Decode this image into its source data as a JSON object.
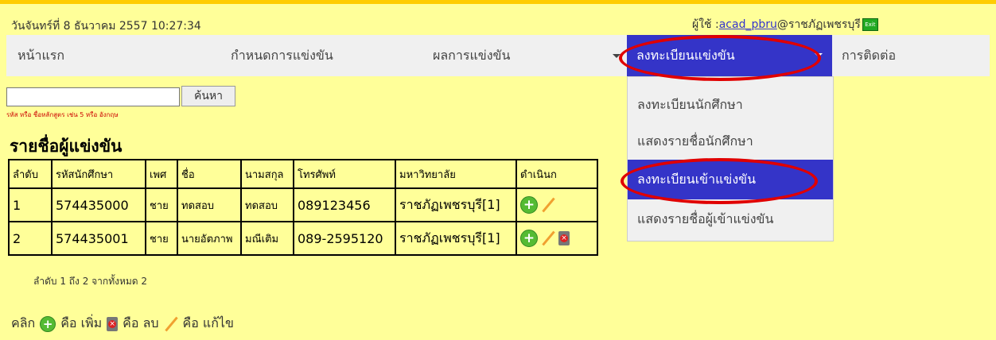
{
  "header": {
    "datetime": "วันจันทร์ที่ 8 ธันวาคม 2557 10:27:34",
    "user_label": "ผู้ใช้ :",
    "username": "acad_pbru",
    "user_org": "@ราชภัฏเพชรบุรี",
    "exit_label": "Exit"
  },
  "nav": {
    "home": "หน้าแรก",
    "schedule": "กำหนดการแข่งขัน",
    "results": "ผลการแข่งขัน",
    "register": "ลงทะเบียนแข่งขัน",
    "contact": "การติดต่อ"
  },
  "dropdown": {
    "items": [
      "ลงทะเบียนนักศึกษา",
      "แสดงรายชื่อนักศึกษา",
      "ลงทะเบียนเข้าแข่งขัน",
      "แสดงรายชื่อผู้เข้าแข่งขัน"
    ],
    "active_index": 2
  },
  "search": {
    "value": "",
    "button": "ค้นหา",
    "hint": "รหัส หรือ ชื่อหลักสูตร เช่น 5 หรือ อังกฤษ"
  },
  "list": {
    "title": "รายชื่อผู้แข่งขัน",
    "columns": [
      "ลำดับ",
      "รหัสนักศึกษา",
      "เพศ",
      "ชื่อ",
      "นามสกุล",
      "โทรศัพท์",
      "มหาวิทยาลัย",
      "ดำเนินก"
    ],
    "rows": [
      {
        "no": "1",
        "student_id": "574435000",
        "gender": "ชาย",
        "first_name": "ทดสอบ",
        "last_name": "ทดสอบ",
        "phone": "089123456",
        "university": "ราชภัฏเพชรบุรี[1]"
      },
      {
        "no": "2",
        "student_id": "574435001",
        "gender": "ชาย",
        "first_name": "นายอัตภาพ",
        "last_name": "มณีเติม",
        "phone": "089-2595120",
        "university": "ราชภัฏเพชรบุรี[1]"
      }
    ],
    "paging": "ลำดับ 1 ถึง 2 จากทั้งหมด 2"
  },
  "legend": {
    "click": "คลิก",
    "add": "คือ เพิ่ม",
    "delete": "คือ ลบ",
    "edit": "คือ แก้ไข"
  },
  "colors": {
    "background": "#ffff99",
    "menu_active": "#3434c8",
    "annotation": "#e00000"
  }
}
